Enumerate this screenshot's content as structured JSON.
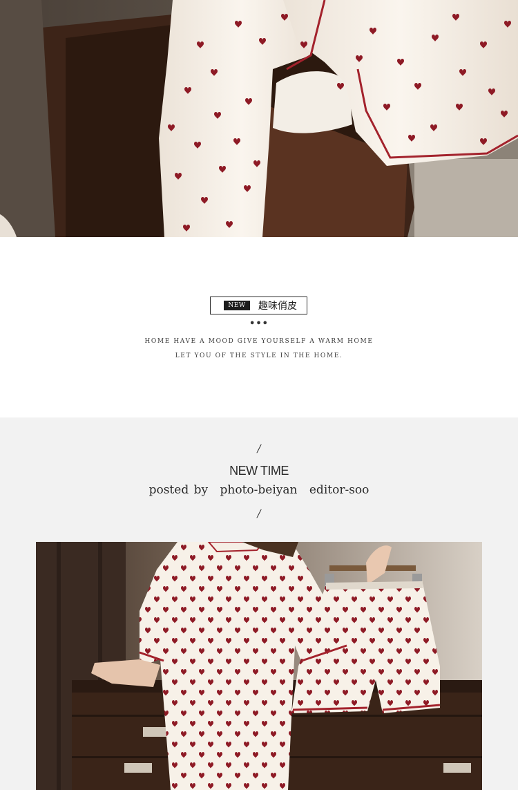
{
  "photos": {
    "top": {
      "alt": "Model wearing white heart-print pajama pants with red piping, sitting on a wooden cabinet"
    },
    "bottom": {
      "alt": "Model in white heart-print short-sleeve pajama shirt holding matching shorts on a hanger"
    }
  },
  "tagline": {
    "badge": "NEW",
    "title": "趣味俏皮",
    "dots": "•••",
    "line1": "HOME HAVE A MOOD GIVE YOURSELF A WARM HOME",
    "line2": "LET YOU OF THE STYLE IN THE HOME."
  },
  "newtime": {
    "slash_top": "/",
    "title": "NEW TIME",
    "posted_label": "posted by",
    "photographer": "photo-beiyan",
    "editor": "editor-soo",
    "slash_bottom": "/"
  },
  "colors": {
    "fabric": "#f6efe6",
    "heart": "#8e1a25",
    "piping": "#a3222c",
    "wood": "#3d2418",
    "gray_bg": "#f2f2f2"
  }
}
